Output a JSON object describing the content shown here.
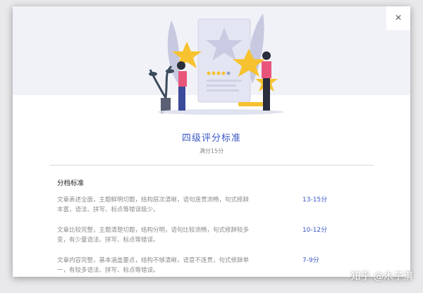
{
  "modal": {
    "title": "四级评分标准",
    "subtitle": "满分15分",
    "close_label": "×"
  },
  "section": {
    "title": "分档标准"
  },
  "criteria": [
    {
      "description": "文章表述全面，主题鲜明切题，结构层次清晰，语句连贯流畅，句式修辞丰富，语法、拼写、标点等错误极少。",
      "score": "13-15分"
    },
    {
      "description": "文章比较完整，主题清楚切题，结构分明，语句比较流畅，句式修辞较多变，有少量语法、拼写、标点等错误。",
      "score": "10-12分"
    },
    {
      "description": "文章内容完整，基本涵盖要点，结构不够清晰，语意不连贯，句式修辞单一，有较多语法、拼写、标点等错误。",
      "score": "7-9分"
    }
  ],
  "watermark": "知乎 @木子淇",
  "colors": {
    "accent": "#3b57c4",
    "hero_bg": "#f1f2f8",
    "star": "#f7c22f"
  },
  "icons": {
    "close": "close-icon",
    "illustration": "rating-illustration"
  }
}
